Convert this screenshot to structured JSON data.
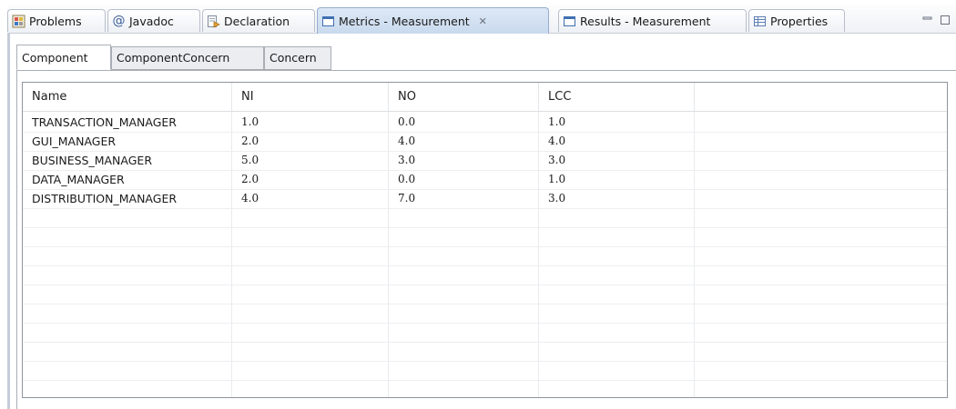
{
  "view_tabs": [
    {
      "label": "Problems",
      "icon": "problems-icon"
    },
    {
      "label": "Javadoc",
      "icon": "at-icon"
    },
    {
      "label": "Declaration",
      "icon": "declaration-icon"
    },
    {
      "label": "Metrics - Measurement",
      "icon": "view-window-icon",
      "active": true,
      "close": "✕"
    },
    {
      "label": "Results - Measurement",
      "icon": "view-window-icon"
    },
    {
      "label": "Properties",
      "icon": "properties-icon"
    }
  ],
  "inner_tabs": [
    {
      "label": "Component",
      "active": true
    },
    {
      "label": "ComponentConcern"
    },
    {
      "label": "Concern"
    }
  ],
  "table": {
    "columns": [
      "Name",
      "NI",
      "NO",
      "LCC",
      ""
    ],
    "rows": [
      [
        "TRANSACTION_MANAGER",
        "1.0",
        "0.0",
        "1.0"
      ],
      [
        "GUI_MANAGER",
        "2.0",
        "4.0",
        "4.0"
      ],
      [
        "BUSINESS_MANAGER",
        "5.0",
        "3.0",
        "3.0"
      ],
      [
        "DATA_MANAGER",
        "2.0",
        "0.0",
        "1.0"
      ],
      [
        "DISTRIBUTION_MANAGER",
        "4.0",
        "7.0",
        "3.0"
      ]
    ]
  },
  "colors": {
    "active_view_tab": "#c9daee",
    "inactive_tab": "#ebedf0",
    "border": "#a9aeb6"
  }
}
